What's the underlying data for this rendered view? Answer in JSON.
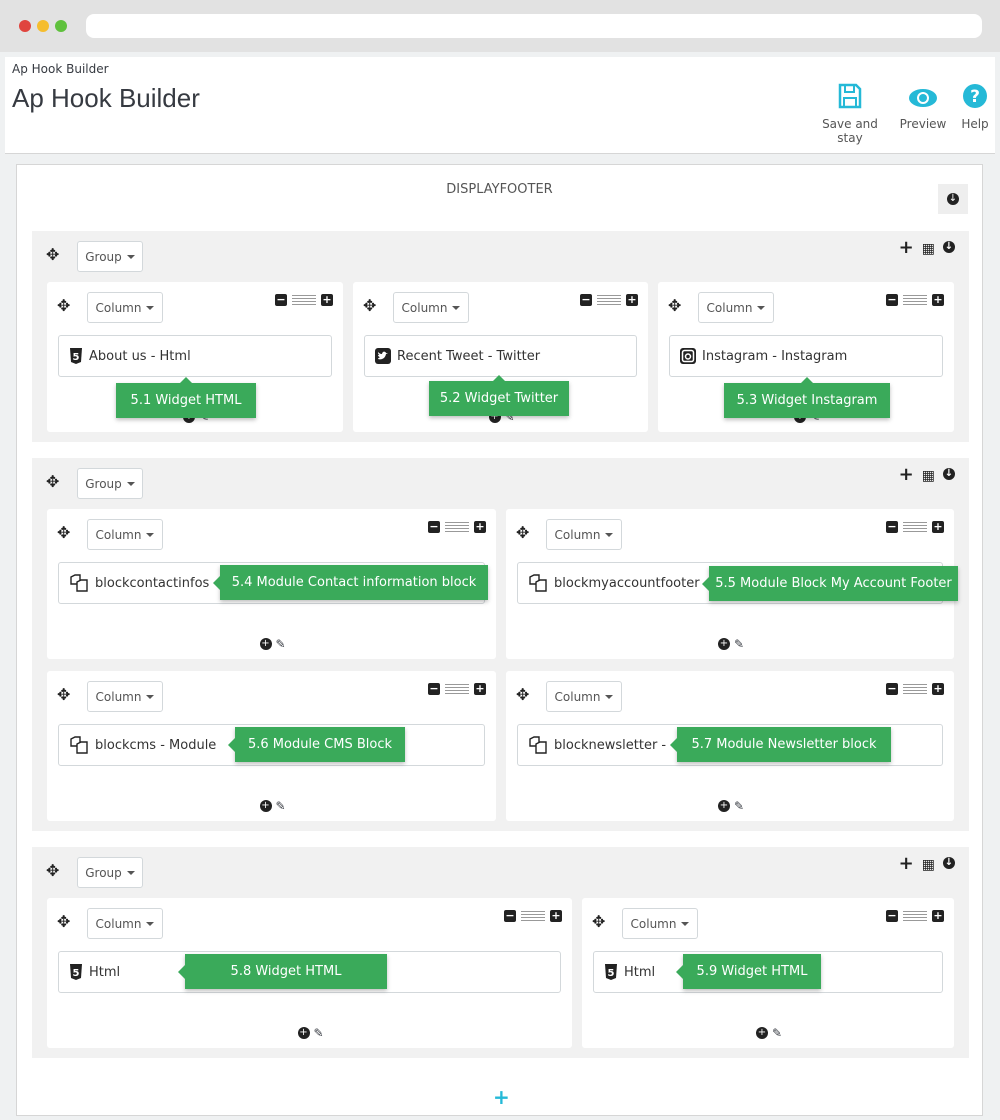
{
  "window": {
    "dots": [
      "#e0443e",
      "#f5bd2e",
      "#5fc13d"
    ]
  },
  "header": {
    "breadcrumb": "Ap Hook Builder",
    "title": "Ap Hook Builder",
    "toolbar": [
      {
        "label": "Save and stay",
        "icon": "save-icon"
      },
      {
        "label": "Preview",
        "icon": "eye-icon"
      },
      {
        "label": "Help",
        "icon": "help-icon"
      }
    ],
    "accent": "#25b9d7"
  },
  "hook": {
    "name": "DISPLAYFOOTER"
  },
  "group_label": "Group",
  "column_label": "Column",
  "tooltip_color": "#3aaa5a",
  "groups": [
    {
      "columns": [
        {
          "widget": "About us - Html",
          "icon": "html5-icon",
          "tooltip": "5.1 Widget HTML"
        },
        {
          "widget": "Recent Tweet - Twitter",
          "icon": "twitter-icon",
          "tooltip": "5.2 Widget Twitter"
        },
        {
          "widget": "Instagram - Instagram",
          "icon": "instagram-icon",
          "tooltip": "5.3 Widget Instagram"
        }
      ]
    },
    {
      "columns": [
        {
          "widget": "blockcontactinfos",
          "icon": "module-icon",
          "tooltip": "5.4 Module Contact information block"
        },
        {
          "widget": "blockmyaccountfooter",
          "icon": "module-icon",
          "tooltip": "5.5 Module Block My Account Footer"
        },
        {
          "widget": "blockcms - Module",
          "icon": "module-icon",
          "tooltip": "5.6 Module CMS Block"
        },
        {
          "widget": "blocknewsletter -",
          "icon": "module-icon",
          "tooltip": "5.7 Module Newsletter block"
        }
      ]
    },
    {
      "columns": [
        {
          "widget": "Html",
          "icon": "html5-icon",
          "tooltip": "5.8 Widget HTML"
        },
        {
          "widget": "Html",
          "icon": "html5-icon",
          "tooltip": "5.9 Widget HTML"
        }
      ]
    }
  ]
}
